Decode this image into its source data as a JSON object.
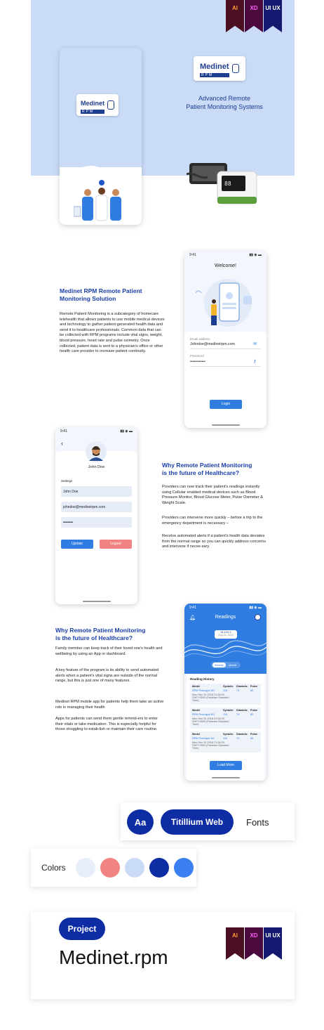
{
  "ribbons": [
    "AI",
    "XD",
    "UI UX"
  ],
  "brand": {
    "name": "Medinet",
    "sub": "RPM"
  },
  "hero": {
    "line1": "Advanced Remote",
    "line2": "Patient Monitoring Systems"
  },
  "section1": {
    "heading_l1": "Medinet RPM Remote Patient",
    "heading_l2": "Monitoring Solution",
    "body": "Remote Patient Monitoring is a subcategory of homecare telehealth that allows patients to use mobile medical devices and technology to gather patient-generated health data and send it to healthcare professionals. Common data that can be collected with RPM programs include vital signs, weight, blood pressure, heart rate and pulse oximetry. Once collected, patient data is sent to a physician's office or other health care provider to increase patient continuity."
  },
  "login": {
    "time": "9:41",
    "title": "Welcome!",
    "email_label": "Email address",
    "email_value": "Johndoe@medinetrpm.com",
    "password_label": "Password",
    "password_value": "••••••••••••",
    "login_button": "Login"
  },
  "profile": {
    "time": "9:41",
    "back": "‹",
    "name": "John Doe",
    "settings_label": "Settings",
    "name_value": "John Doe",
    "email_value": "johndoe@medinetrpm.com",
    "password_value": "••••••••",
    "update_button": "Update",
    "logout_button": "Logout"
  },
  "section2": {
    "heading_l1": "Why Remote Patient Monitoring",
    "heading_l2": "is the future of Healthcare?",
    "p1": "Providers can now track their patient's readings instantly using Cellular enabled medical devices such as Blood Pressure Monitor, Blood Glucose Meter, Pulse Oximeter & Weight Scale.",
    "p2": "Providers can intervene more quickly – before a trip to the emergency department is necessary –",
    "p3": "Receive automated alerts if a patient's health data deviates from the normal range so you can quickly address concerns and intervene if neces-sary."
  },
  "section3": {
    "heading_l1": "Why Remote Patient Monitoring",
    "heading_l2": "is the future of Healthcare?",
    "p1": "Family member can keep track of their loved one's health and wellbeing by using an App or dashboard.",
    "p2": "A key feature of the program is its ability to send automated alerts when a patient's vital signs are outside of the normal range, but this is just one of many features.",
    "p3": "Medinet RPM mobile app for patients help them take an active role in managing their health",
    "p4": "Apps for patients can send them gentle remind-ers to enter their vitals or take medication. This is especially helpful for those struggling to estab-lish or maintain their care routine."
  },
  "readings": {
    "time": "9:41",
    "title": "Readings",
    "tooltip_value": "94.1/91.5",
    "tooltip_date": "Aug 31, 2019",
    "tab_weekly": "Weekly",
    "tab_month": "Month",
    "history_title": "Reading History",
    "col_model": "Model",
    "col_systolic": "Systolic",
    "col_diastolic": "Diastolic",
    "col_pulse": "Pulse",
    "rows": [
      {
        "model": "RPM Prototype M1",
        "systolic": "116",
        "diastolic": "74",
        "pulse": "80",
        "date": "Mon Dec 31 2018 21:08:00 GMT+0500 (Pakistan Standard Time)"
      },
      {
        "model": "RPM Prototype M1",
        "systolic": "116",
        "diastolic": "74",
        "pulse": "80",
        "date": "Mon Dec 31 2018 21:08:00 GMT+0500 (Pakistan Standard Time)"
      },
      {
        "model": "RPM Prototype M1",
        "systolic": "116",
        "diastolic": "74",
        "pulse": "80",
        "date": "Mon Dec 31 2018 21:08:00 GMT+0500 (Pakistan Standard Time)"
      }
    ],
    "load_more": "Load More"
  },
  "fonts": {
    "aa": "Aa",
    "font_name": "Titillium Web",
    "label": "Fonts"
  },
  "colors": {
    "label": "Colors",
    "swatches": [
      "#e8eef9",
      "#f28383",
      "#c9dbf7",
      "#0e2ca3",
      "#3c7ff0"
    ]
  },
  "project": {
    "tag": "Project",
    "name": "Medinet.rpm"
  }
}
